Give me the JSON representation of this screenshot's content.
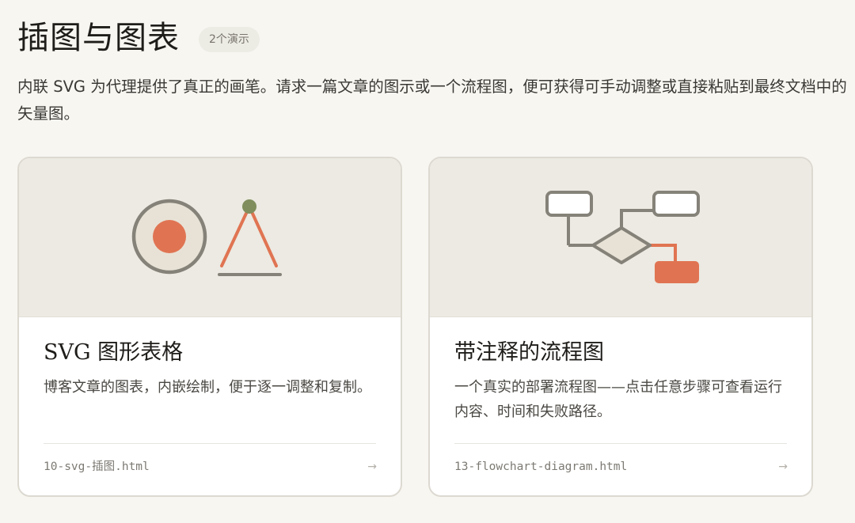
{
  "header": {
    "title": "插图与图表",
    "badge": "2个演示"
  },
  "intro": "内联 SVG 为代理提供了真正的画笔。请求一篇文章的图示或一个流程图，便可获得可手动调整或直接粘贴到最终文档中的矢量图。",
  "colors": {
    "accent": "#e07452",
    "olive": "#7f8e5c",
    "stroke": "#858279",
    "thumb_bg": "#eceae2",
    "node_fill": "#e8e2d6"
  },
  "cards": [
    {
      "title": "SVG 图形表格",
      "description": "博客文章的图表，内嵌绘制，便于逐一调整和复制。",
      "filename": "10-svg-插图.html",
      "arrow": "→",
      "icon": "circle-and-triangle-illustration"
    },
    {
      "title": "带注释的流程图",
      "description": "一个真实的部署流程图——点击任意步骤可查看运行内容、时间和失败路径。",
      "filename": "13-flowchart-diagram.html",
      "arrow": "→",
      "icon": "flowchart-illustration"
    }
  ]
}
